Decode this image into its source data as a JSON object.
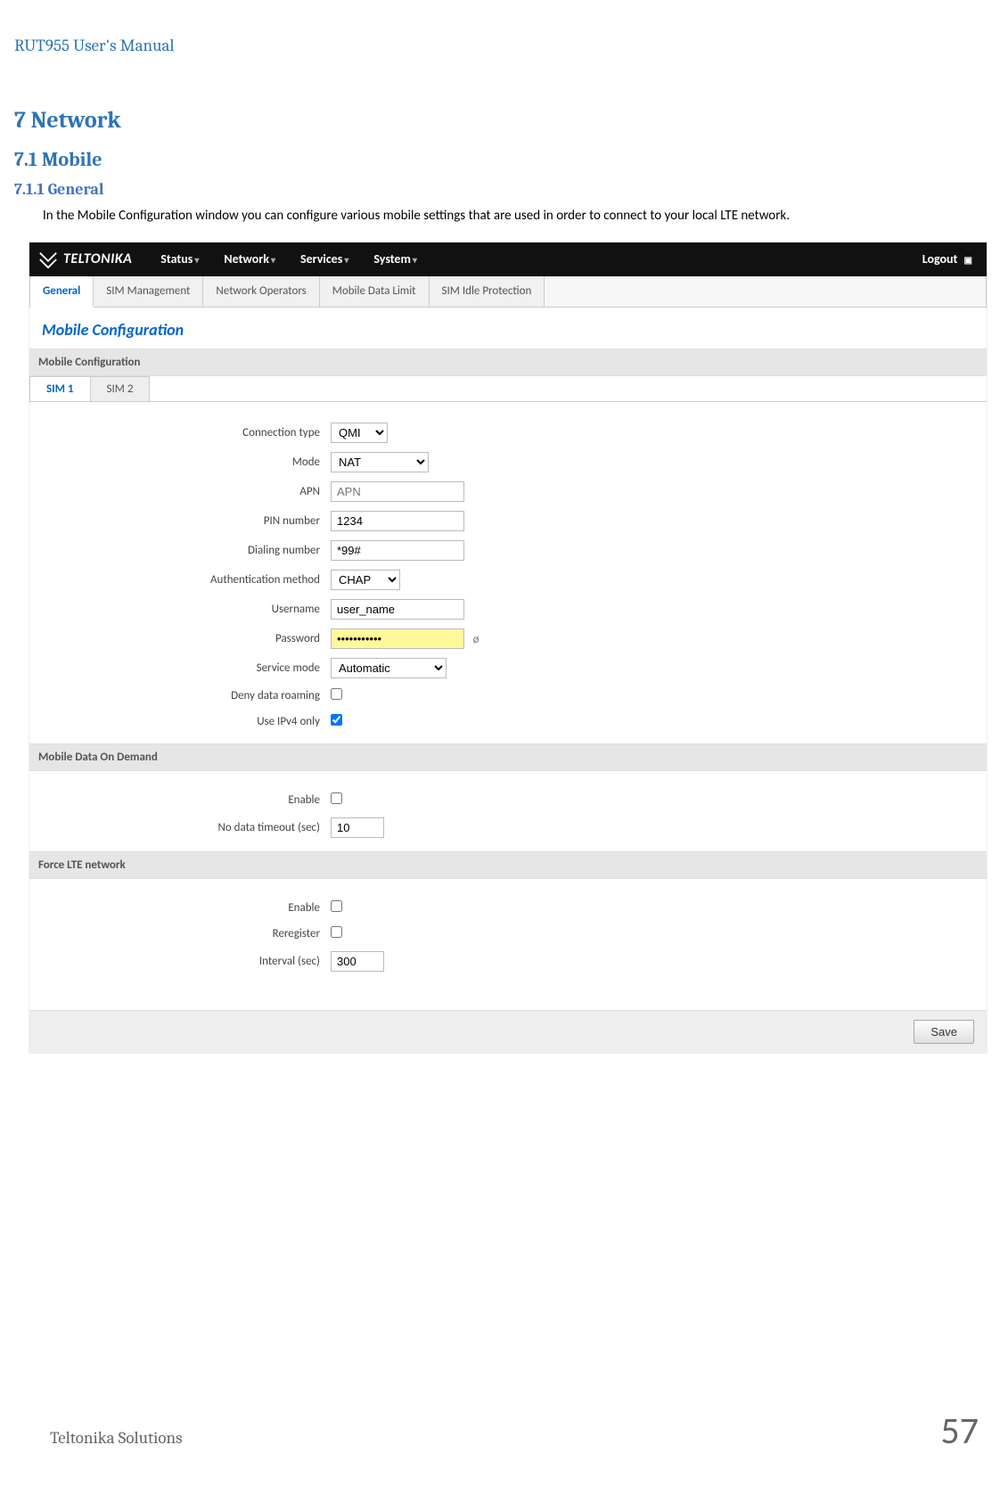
{
  "doc": {
    "header": "RUT955 User's Manual",
    "h1": "7    Network",
    "h2": "7.1   Mobile",
    "h3": "7.1.1 General",
    "para": "In the Mobile Configuration window you can configure various mobile settings that are used in order to connect to your local LTE network.",
    "footer_text": "Teltonika Solutions",
    "page_number": "57"
  },
  "ui": {
    "brand": "TELTONIKA",
    "nav": {
      "status": "Status",
      "network": "Network",
      "services": "Services",
      "system": "System",
      "logout": "Logout"
    },
    "tabs": {
      "general": "General",
      "sim_management": "SIM Management",
      "network_operators": "Network Operators",
      "mobile_data_limit": "Mobile Data Limit",
      "sim_idle_protection": "SIM Idle Protection"
    },
    "page_title": "Mobile Configuration",
    "sections": {
      "mobile_configuration": "Mobile Configuration",
      "mobile_data_on_demand": "Mobile Data On Demand",
      "force_lte_network": "Force LTE network"
    },
    "simtabs": {
      "sim1": "SIM 1",
      "sim2": "SIM 2"
    },
    "fields": {
      "connection_type": {
        "label": "Connection type",
        "value": "QMI"
      },
      "mode": {
        "label": "Mode",
        "value": "NAT"
      },
      "apn": {
        "label": "APN",
        "placeholder": "APN",
        "value": ""
      },
      "pin_number": {
        "label": "PIN number",
        "value": "1234"
      },
      "dialing_number": {
        "label": "Dialing number",
        "value": "*99#"
      },
      "authentication_method": {
        "label": "Authentication method",
        "value": "CHAP"
      },
      "username": {
        "label": "Username",
        "value": "user_name"
      },
      "password": {
        "label": "Password",
        "value": "•••••••••••"
      },
      "service_mode": {
        "label": "Service mode",
        "value": "Automatic"
      },
      "deny_data_roaming": {
        "label": "Deny data roaming"
      },
      "use_ipv4_only": {
        "label": "Use IPv4 only"
      },
      "mdod_enable": {
        "label": "Enable"
      },
      "no_data_timeout": {
        "label": "No data timeout (sec)",
        "value": "10"
      },
      "flte_enable": {
        "label": "Enable"
      },
      "reregister": {
        "label": "Reregister"
      },
      "interval": {
        "label": "Interval (sec)",
        "value": "300"
      }
    },
    "save": "Save"
  }
}
